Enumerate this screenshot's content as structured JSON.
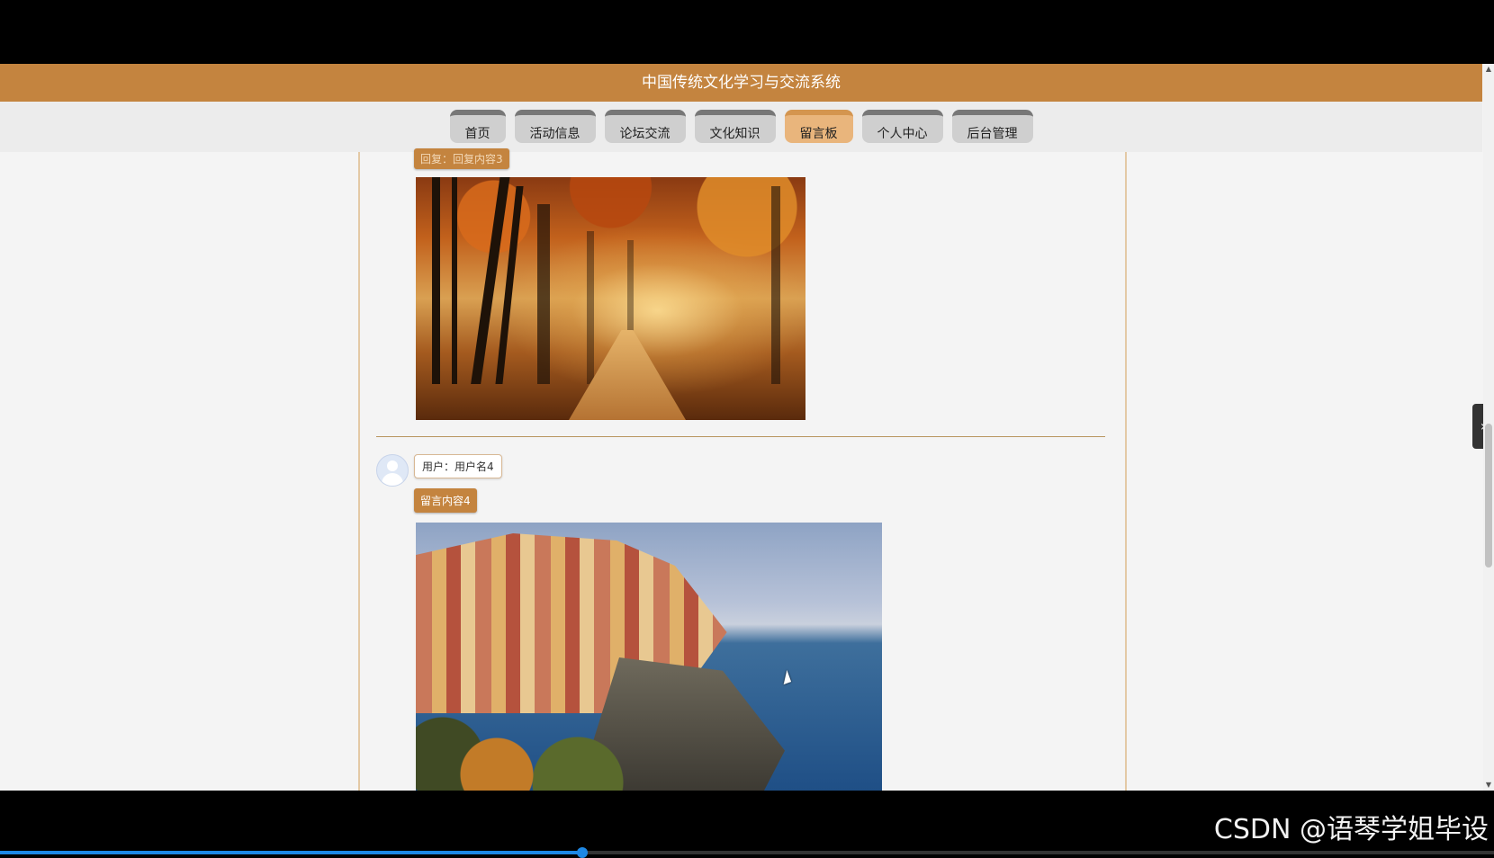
{
  "site": {
    "title": "中国传统文化学习与交流系统"
  },
  "nav": {
    "items": [
      {
        "label": "首页",
        "active": false
      },
      {
        "label": "活动信息",
        "active": false
      },
      {
        "label": "论坛交流",
        "active": false
      },
      {
        "label": "文化知识",
        "active": false
      },
      {
        "label": "留言板",
        "active": true
      },
      {
        "label": "个人中心",
        "active": false
      },
      {
        "label": "后台管理",
        "active": false
      }
    ]
  },
  "messages": [
    {
      "reply": "回复：回复内容3",
      "image": "autumn-forest-photo"
    },
    {
      "user": "用户：用户名4",
      "content": "留言内容4",
      "image": "coastal-town-photo"
    }
  ],
  "watermark": "CSDN @语琴学姐毕设",
  "video": {
    "progress": 0.39
  },
  "colors": {
    "brand": "#c4843f",
    "active_tab": "#e9b57c",
    "progress": "#1e88e5"
  }
}
